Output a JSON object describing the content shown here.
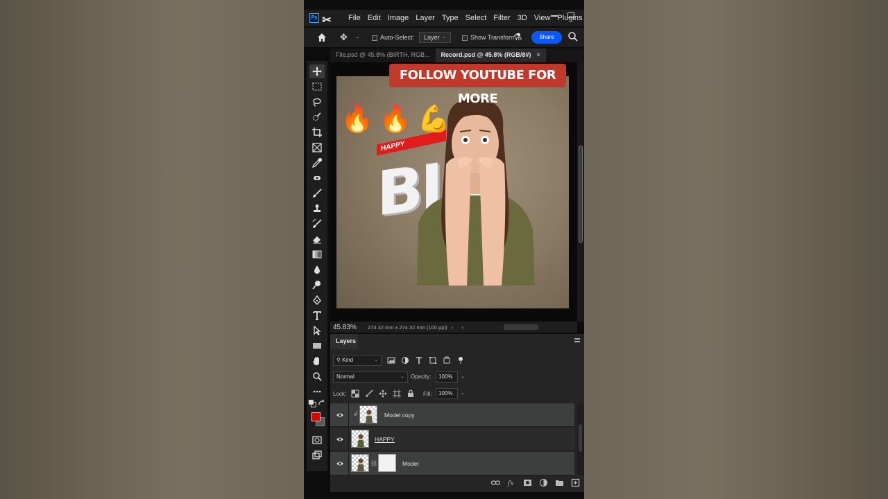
{
  "app": {
    "logo": "Ps",
    "menu": [
      "File",
      "Edit",
      "Image",
      "Layer",
      "Type",
      "Select",
      "Filter",
      "3D",
      "View",
      "Plugins"
    ]
  },
  "options": {
    "auto_select": "Auto-Select:",
    "layer_dropdown": "Layer",
    "show_transform": "Show Transform",
    "share": "Share"
  },
  "tabs": [
    {
      "label": "File.psd @ 45.8% (BIRTH, RGB..."
    },
    {
      "label": "Record.psd @ 45.8% (RGB/8#)"
    }
  ],
  "canvas": {
    "banner": "FOLLOW YOUTUBE FOR MORE",
    "emojis": [
      "🔥",
      "🔥",
      "💪"
    ],
    "ribbon_text": "HAPPY",
    "big_text": "BIR",
    "big_text2": "I"
  },
  "status": {
    "zoom": "45.83%",
    "doc_size": "274.32 mm x 274.32 mm (100 ppi)"
  },
  "layers_panel": {
    "title": "Layers",
    "kind": "Kind",
    "blend_mode": "Normal",
    "opacity_label": "Opacity:",
    "opacity": "100%",
    "lock_label": "Lock:",
    "fill_label": "Fill:",
    "fill": "100%",
    "layers": [
      {
        "name": "Model copy"
      },
      {
        "name": "HAPPY"
      },
      {
        "name": "Model"
      }
    ]
  },
  "colors": {
    "foreground": "#e00000",
    "background": "#5a5a5a",
    "accent": "#0b58ff",
    "banner": "#c0392b"
  }
}
